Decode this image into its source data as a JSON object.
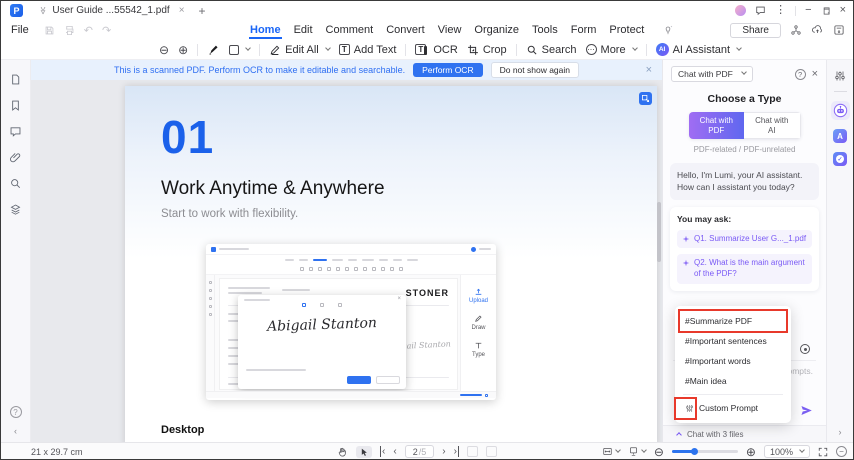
{
  "window": {
    "tab_title": "User Guide ...55542_1.pdf",
    "file_menu": "File",
    "menus": [
      "Home",
      "Edit",
      "Comment",
      "Convert",
      "View",
      "Organize",
      "Tools",
      "Form",
      "Protect"
    ],
    "share": "Share"
  },
  "toolbar": {
    "edit_all": "Edit All",
    "add_text": "Add Text",
    "ocr": "OCR",
    "crop": "Crop",
    "search": "Search",
    "more": "More",
    "ai_badge": "AI",
    "ai_assistant": "AI Assistant"
  },
  "notification": {
    "message": "This is a scanned PDF. Perform OCR to make it editable and searchable.",
    "perform_ocr": "Perform OCR",
    "dismiss": "Do not show again"
  },
  "document": {
    "chapter_number": "01",
    "title": "Work Anytime & Anywhere",
    "subtitle": "Start to work with flexibility.",
    "section_heading": "Desktop",
    "embed": {
      "brand": "STONER",
      "signature": "Abigail Stanton",
      "rail": [
        "Upload",
        "Draw",
        "Type"
      ]
    }
  },
  "ai_panel": {
    "mode_dropdown": "Chat with PDF",
    "choose_type": "Choose a Type",
    "type_pdf_line1": "Chat with",
    "type_pdf_line2": "PDF",
    "type_ai_line1": "Chat with",
    "type_ai_line2": "AI",
    "type_caption": "PDF-related / PDF-unrelated",
    "greeting": "Hello, I'm Lumi, your AI assistant. How can I assistant you today?",
    "you_may_ask": "You may ask:",
    "suggestions": [
      "Q1. Summarize User G..._1.pdf",
      "Q2. What is the main argument of the PDF?"
    ],
    "prompt_menu": [
      "#Summarize PDF",
      "#Important sentences",
      "#Important words",
      "#Main idea"
    ],
    "custom_prompt": "Custom Prompt",
    "input_fragment": "ompts.",
    "files_bar": "Chat with 3 files"
  },
  "status_bar": {
    "page_size": "21 x 29.7 cm",
    "page_current": "2",
    "page_total": "/5",
    "zoom": "100%"
  },
  "icons": {
    "close": "×",
    "plus": "+",
    "minimize": "−",
    "kebab": "⋮",
    "tab_list": "≫",
    "zoom_out": "⊖",
    "zoom_in": "⊕",
    "more_dots": "…",
    "prev": "‹",
    "next": "›",
    "help": "?",
    "undo": "↶",
    "redo": "↷",
    "check": "✓",
    "minus": "−",
    "logo": "P"
  },
  "colors": {
    "accent_blue": "#2170f4",
    "accent_purple": "#7a5af5",
    "annotation_red": "#e8392b"
  }
}
